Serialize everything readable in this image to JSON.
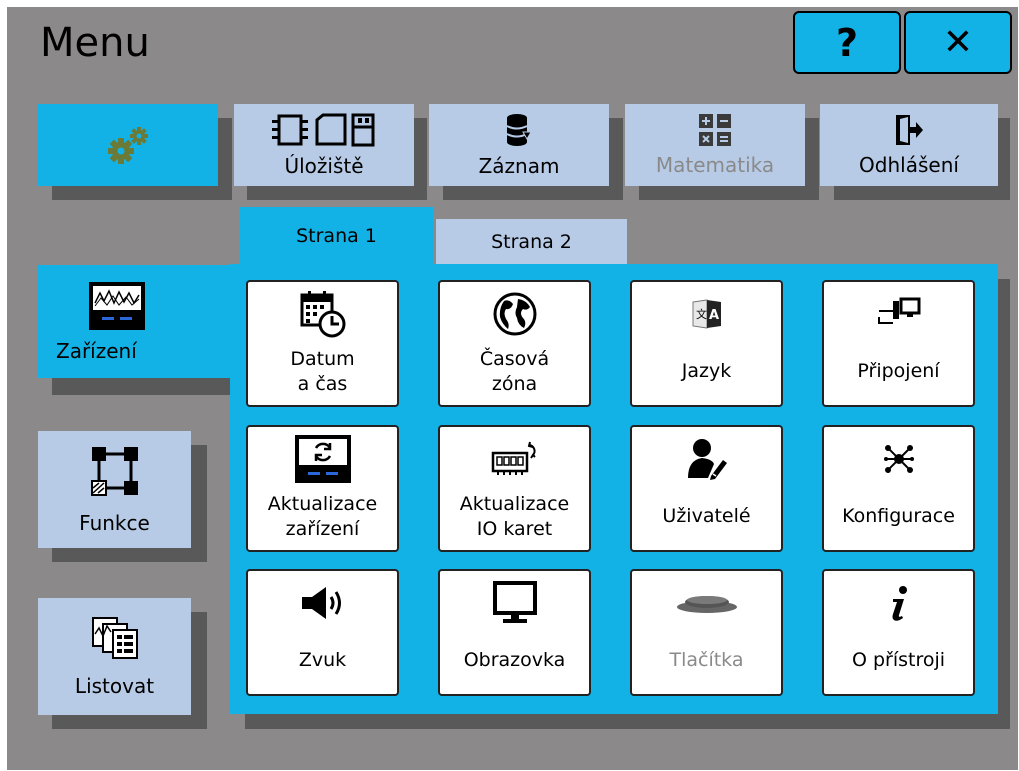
{
  "header": {
    "title": "Menu",
    "help_label": "?",
    "close_label": "✕"
  },
  "toolbar": {
    "settings": {
      "icon": "gears-icon"
    },
    "storage": {
      "label": "Úložiště",
      "icon": "storage-devices-icon"
    },
    "record": {
      "label": "Záznam",
      "icon": "database-icon"
    },
    "math": {
      "label": "Matematika",
      "icon": "calculator-icon",
      "disabled": true
    },
    "logout": {
      "label": "Odhlášení",
      "icon": "logout-icon"
    }
  },
  "sidebar": {
    "device": {
      "label": "Zařízení",
      "icon": "device-display-icon"
    },
    "functions": {
      "label": "Funkce",
      "icon": "function-blocks-icon"
    },
    "browse": {
      "label": "Listovat",
      "icon": "browse-pages-icon"
    }
  },
  "tabs": [
    {
      "label": "Strana 1",
      "active": true
    },
    {
      "label": "Strana 2",
      "active": false
    }
  ],
  "tiles": [
    {
      "label": "Datum\na čas",
      "icon": "calendar-clock-icon"
    },
    {
      "label": "Časová\nzóna",
      "icon": "globe-icon"
    },
    {
      "label": "Jazyk",
      "icon": "language-icon"
    },
    {
      "label": "Připojení",
      "icon": "network-connection-icon"
    },
    {
      "label": "Aktualizace\nzařízení",
      "icon": "device-update-icon"
    },
    {
      "label": "Aktualizace\nIO karet",
      "icon": "io-card-update-icon"
    },
    {
      "label": "Uživatelé",
      "icon": "user-edit-icon"
    },
    {
      "label": "Konfigurace",
      "icon": "configuration-icon"
    },
    {
      "label": "Zvuk",
      "icon": "speaker-icon"
    },
    {
      "label": "Obrazovka",
      "icon": "monitor-icon"
    },
    {
      "label": "Tlačítka",
      "icon": "button-icon",
      "disabled": true
    },
    {
      "label": "O přístroji",
      "icon": "info-icon"
    }
  ]
}
